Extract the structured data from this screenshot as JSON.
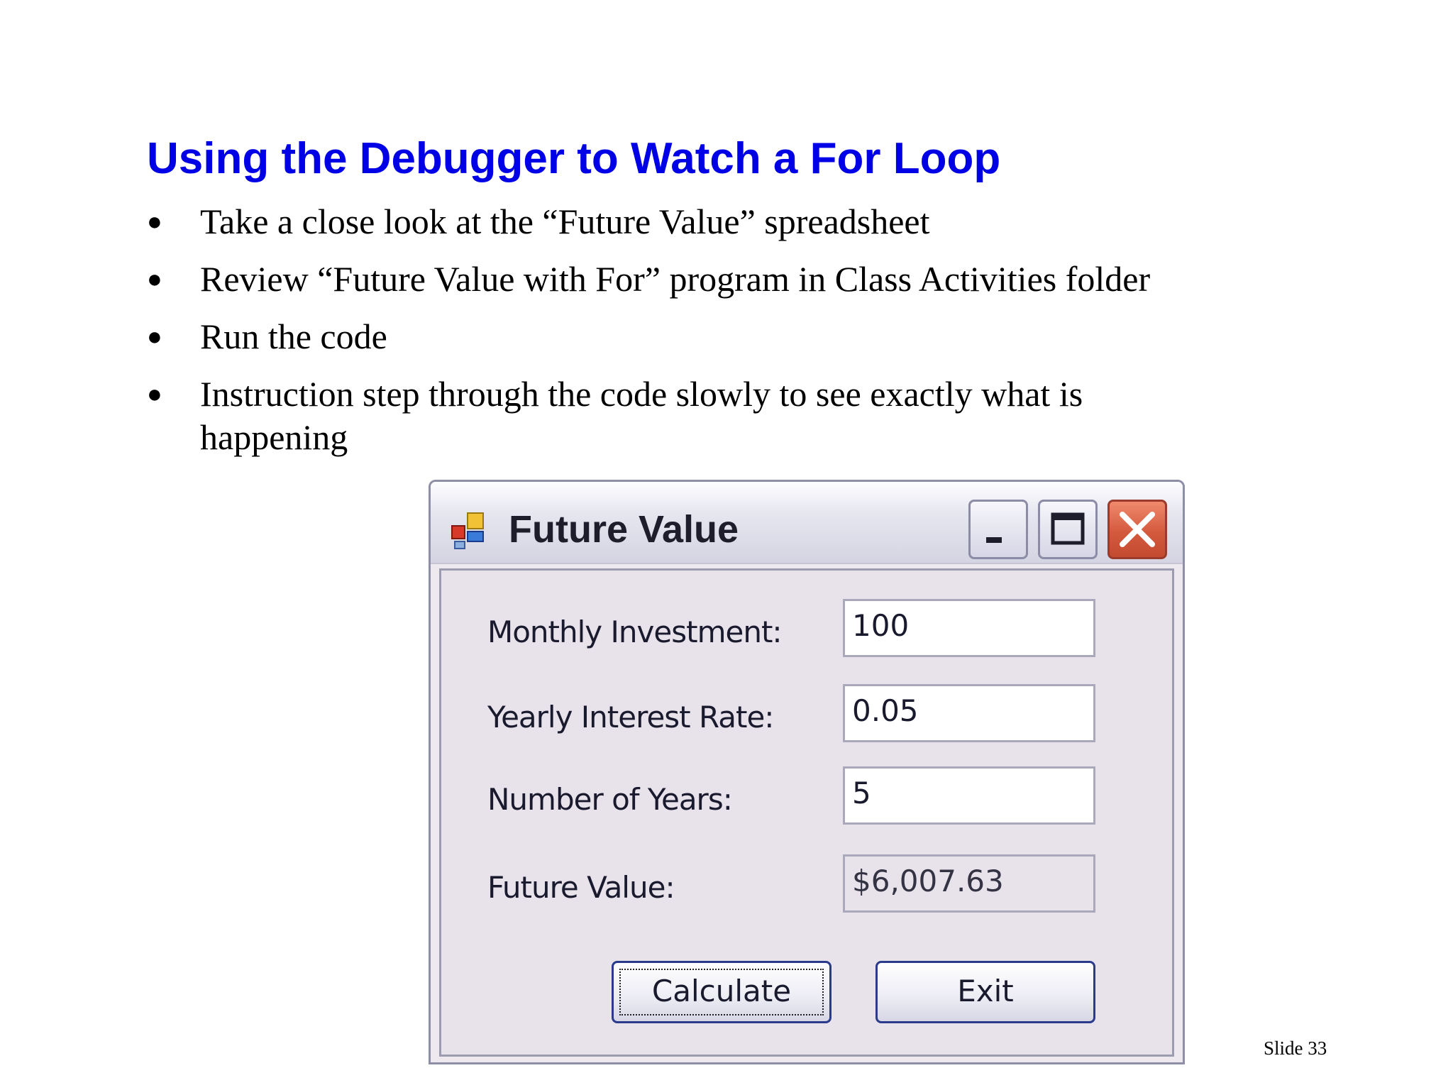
{
  "slide": {
    "title": "Using the Debugger to Watch a For Loop",
    "bullets": [
      "Take a close look at the “Future Value” spreadsheet",
      "Review “Future Value with For” program in Class Activities folder",
      "Run the code",
      "Instruction step through the code slowly to see exactly what is happening"
    ],
    "slide_number": "Slide 33"
  },
  "window": {
    "title": "Future Value",
    "icon": "app-form-icon",
    "controls": [
      "minimize-icon",
      "maximize-icon",
      "close-icon"
    ],
    "fields": [
      {
        "label": "Monthly Investment:",
        "value": "100",
        "readonly": false
      },
      {
        "label": "Yearly Interest Rate:",
        "value": "0.05",
        "readonly": false
      },
      {
        "label": "Number of Years:",
        "value": "5",
        "readonly": false
      },
      {
        "label": "Future Value:",
        "value": "$6,007.63",
        "readonly": true
      }
    ],
    "buttons": {
      "calculate": "Calculate",
      "exit": "Exit"
    }
  },
  "colors": {
    "title": "#0000e6",
    "close_button": "#d45a3e"
  }
}
